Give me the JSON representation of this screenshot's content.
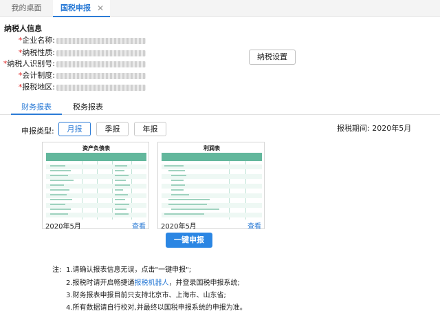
{
  "tabs": [
    {
      "label": "我的桌面"
    },
    {
      "label": "国税申报",
      "close": "✕"
    }
  ],
  "taxpayer": {
    "title": "纳税人信息",
    "required_mark": "*",
    "fields": [
      {
        "label": "企业名称:"
      },
      {
        "label": "纳税性质:"
      },
      {
        "label": "纳税人识别号:"
      },
      {
        "label": "会计制度:"
      },
      {
        "label": "报税地区:"
      }
    ],
    "settings_button": "纳税设置"
  },
  "report_tabs": [
    {
      "label": "财务报表",
      "active": true
    },
    {
      "label": "税务报表",
      "active": false
    }
  ],
  "period": {
    "type_label": "申报类型:",
    "options": [
      {
        "label": "月报",
        "active": true
      },
      {
        "label": "季报",
        "active": false
      },
      {
        "label": "年报",
        "active": false
      }
    ],
    "report_period": "报税期间: 2020年5月"
  },
  "reports": [
    {
      "title": "资产负债表",
      "date": "2020年5月",
      "view": "查看"
    },
    {
      "title": "利润表",
      "date": "2020年5月",
      "view": "查看"
    }
  ],
  "submit_button": "一键申报",
  "notes": {
    "label": "注:",
    "items": [
      {
        "text": "1.请确认报表信息无误，点击\"一键申报\";"
      },
      {
        "before": "2.报税时请开启畅捷通",
        "link": "报税机器人",
        "after": "，并登录国税申报系统;"
      },
      {
        "text": "3.财务报表申报目前只支持北京市、上海市、山东省;"
      },
      {
        "text": "4.所有数据请自行校对,并最终以国税申报系统的申报为准。"
      }
    ]
  },
  "colors": {
    "accent": "#2b7bd6",
    "required": "#e02020",
    "table_header": "#62b79c"
  }
}
